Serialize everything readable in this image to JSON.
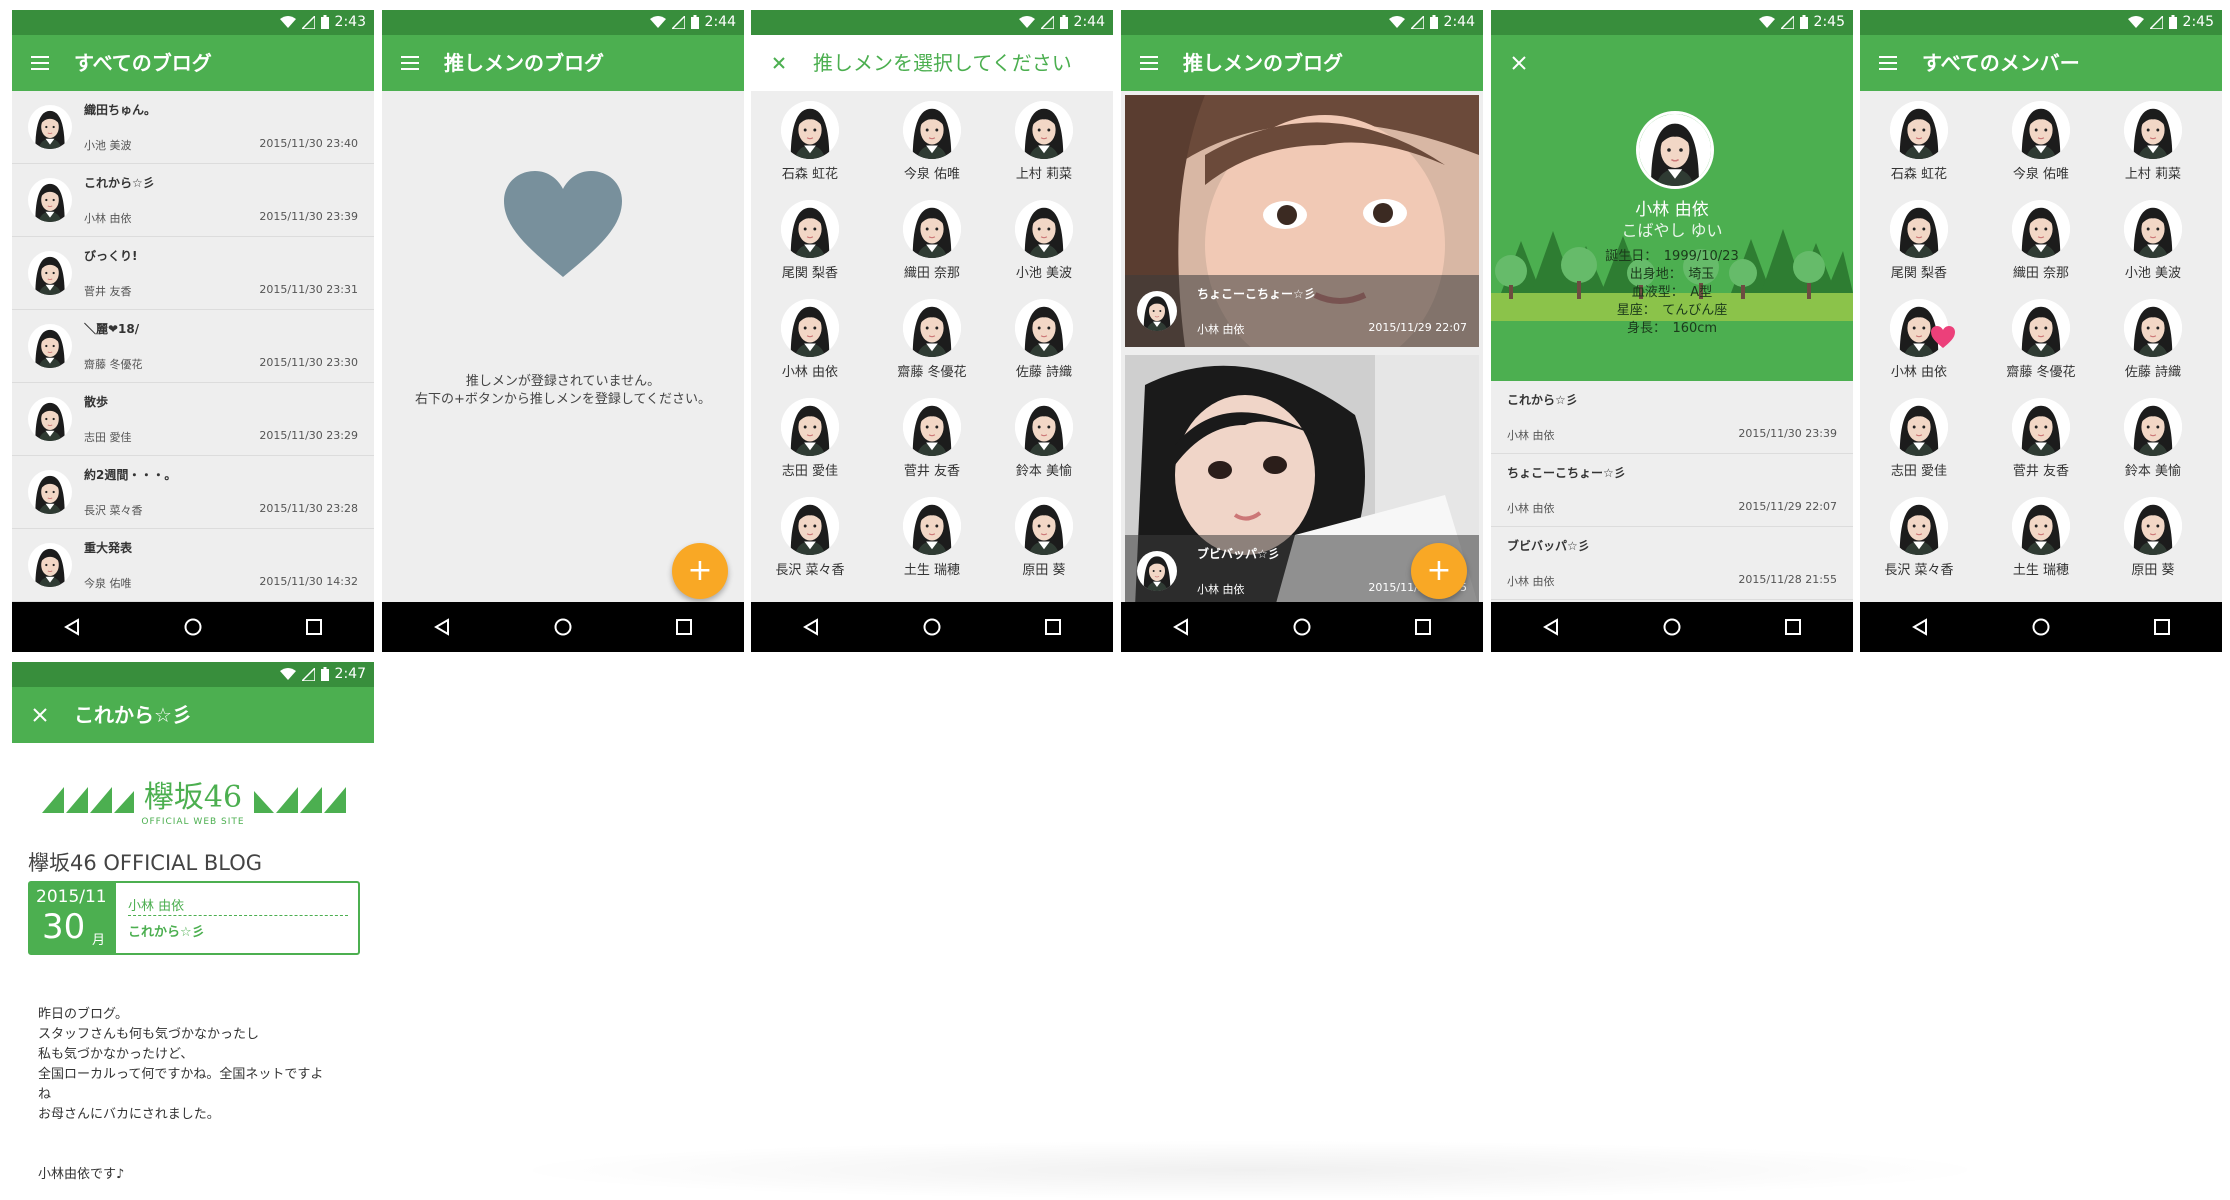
{
  "colors": {
    "primary": "#4caf50",
    "primary_dark": "#388e3c",
    "accent": "#f9a825",
    "heart_grey": "#78909c",
    "heart_pink": "#ec407a"
  },
  "screens": {
    "s1": {
      "time": "2:43",
      "title": "すべてのブログ",
      "nav_icon": "menu-icon",
      "items": [
        {
          "title": "織田ちゅん。",
          "name": "小池 美波",
          "date": "2015/11/30 23:40"
        },
        {
          "title": "これから☆彡",
          "name": "小林 由依",
          "date": "2015/11/30 23:39"
        },
        {
          "title": "びっくり!",
          "name": "菅井 友香",
          "date": "2015/11/30 23:31"
        },
        {
          "title": "＼麗❤18/",
          "name": "齋藤 冬優花",
          "date": "2015/11/30 23:30"
        },
        {
          "title": "散歩",
          "name": "志田 愛佳",
          "date": "2015/11/30 23:29"
        },
        {
          "title": "約2週間・・・。",
          "name": "長沢 菜々香",
          "date": "2015/11/30 23:28"
        },
        {
          "title": "重大発表",
          "name": "今泉 佑唯",
          "date": "2015/11/30 14:32"
        }
      ]
    },
    "s2": {
      "time": "2:44",
      "title": "推しメンのブログ",
      "empty_line1": "推しメンが登録されていません。",
      "empty_line2": "右下の+ボタンから推しメンを登録してください。",
      "fab_label": "+"
    },
    "s3": {
      "time": "2:44",
      "title": "推しメンを選択してください",
      "members": [
        "石森 虹花",
        "今泉 佑唯",
        "上村 莉菜",
        "尾関 梨香",
        "織田 奈那",
        "小池 美波",
        "小林 由依",
        "齋藤 冬優花",
        "佐藤 詩織",
        "志田 愛佳",
        "菅井 友香",
        "鈴本 美愉",
        "長沢 菜々香",
        "土生 瑞穂",
        "原田 葵"
      ]
    },
    "s4": {
      "time": "2:44",
      "title": "推しメンのブログ",
      "cards": [
        {
          "title": "ちょこーこちょー☆彡",
          "name": "小林 由依",
          "date": "2015/11/29 22:07"
        },
        {
          "title": "ブビバッパ☆彡",
          "name": "小林 由依",
          "date": "2015/11/28 21:55"
        }
      ],
      "fab_label": "+"
    },
    "s5": {
      "time": "2:45",
      "name": "小林 由依",
      "kana": "こばやし ゆい",
      "info": [
        "誕生日：　1999/10/23",
        "出身地：　埼玉",
        "血液型：　A型",
        "星座：　てんびん座",
        "身長：　160cm"
      ],
      "entries": [
        {
          "title": "これから☆彡",
          "name": "小林 由依",
          "date": "2015/11/30 23:39"
        },
        {
          "title": "ちょこーこちょー☆彡",
          "name": "小林 由依",
          "date": "2015/11/29 22:07"
        },
        {
          "title": "ブビバッパ☆彡",
          "name": "小林 由依",
          "date": "2015/11/28 21:55"
        }
      ]
    },
    "s6": {
      "time": "2:45",
      "title": "すべてのメンバー",
      "members": [
        "石森 虹花",
        "今泉 佑唯",
        "上村 莉菜",
        "尾関 梨香",
        "織田 奈那",
        "小池 美波",
        "小林 由依",
        "齋藤 冬優花",
        "佐藤 詩織",
        "志田 愛佳",
        "菅井 友香",
        "鈴本 美愉",
        "長沢 菜々香",
        "土生 瑞穂",
        "原田 葵"
      ],
      "favorite": "小林 由依"
    },
    "s7": {
      "time": "2:47",
      "title": "これから☆彡",
      "logo_text": "欅坂46",
      "logo_sub": "OFFICIAL WEB SITE",
      "blog_heading": "欅坂46 OFFICIAL BLOG",
      "date_ym": "2015/11",
      "date_day": "30",
      "date_unit": "月",
      "author": "小林 由依",
      "post_title": "これから☆彡",
      "body": [
        "昨日のブログ。",
        "スタッフさんも何も気づかなかったし",
        "私も気づかなかったけど、",
        "全国ローカルって何ですかね。全国ネットですよ",
        "ね",
        "お母さんにバカにされました。",
        "",
        "",
        "小林由依です♪"
      ]
    }
  }
}
